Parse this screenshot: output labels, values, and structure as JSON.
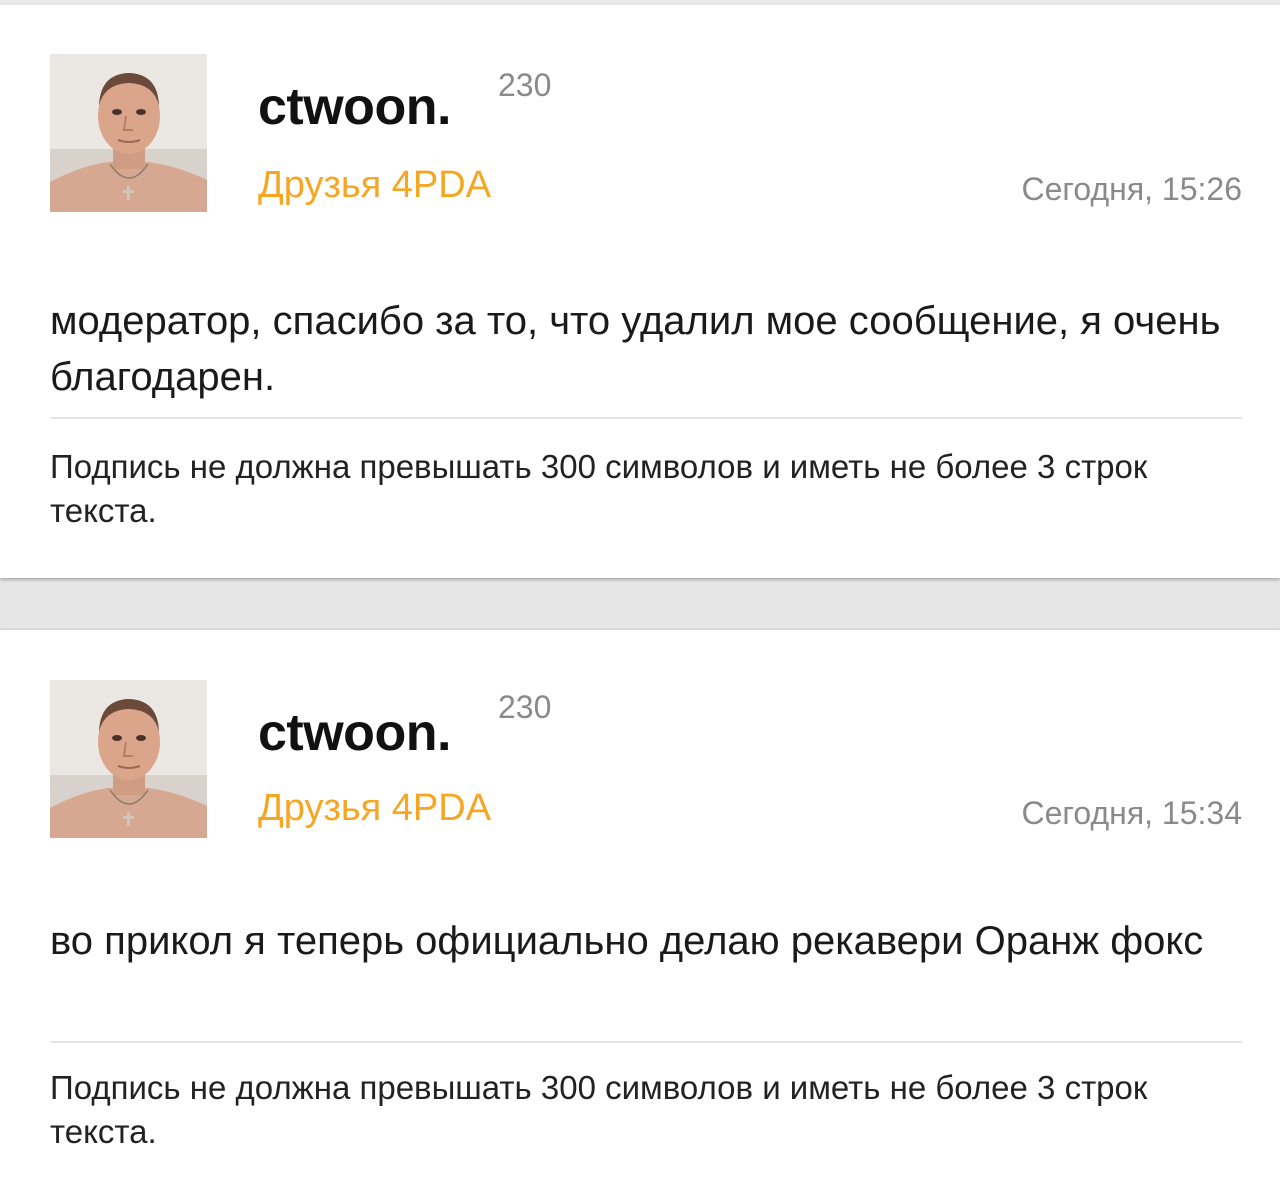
{
  "posts": [
    {
      "username": "ctwoon.",
      "reputation": "230",
      "group": "Друзья 4PDA",
      "time": "Сегодня, 15:26",
      "message": "модератор, спасибо за то, что удалил мое сообщение, я очень благодарен.",
      "signature": "Подпись не должна превышать 300 символов и иметь не более 3 строк текста."
    },
    {
      "username": "ctwoon.",
      "reputation": "230",
      "group": "Друзья 4PDA",
      "time": "Сегодня, 15:34",
      "message": "во прикол я теперь официально делаю рекавери Оранж фокс",
      "signature": "Подпись не должна превышать 300 символов и иметь не более 3 строк текста."
    }
  ],
  "colors": {
    "group": "#f5a623",
    "meta": "#8a8a8a",
    "background": "#e6e6e6"
  }
}
